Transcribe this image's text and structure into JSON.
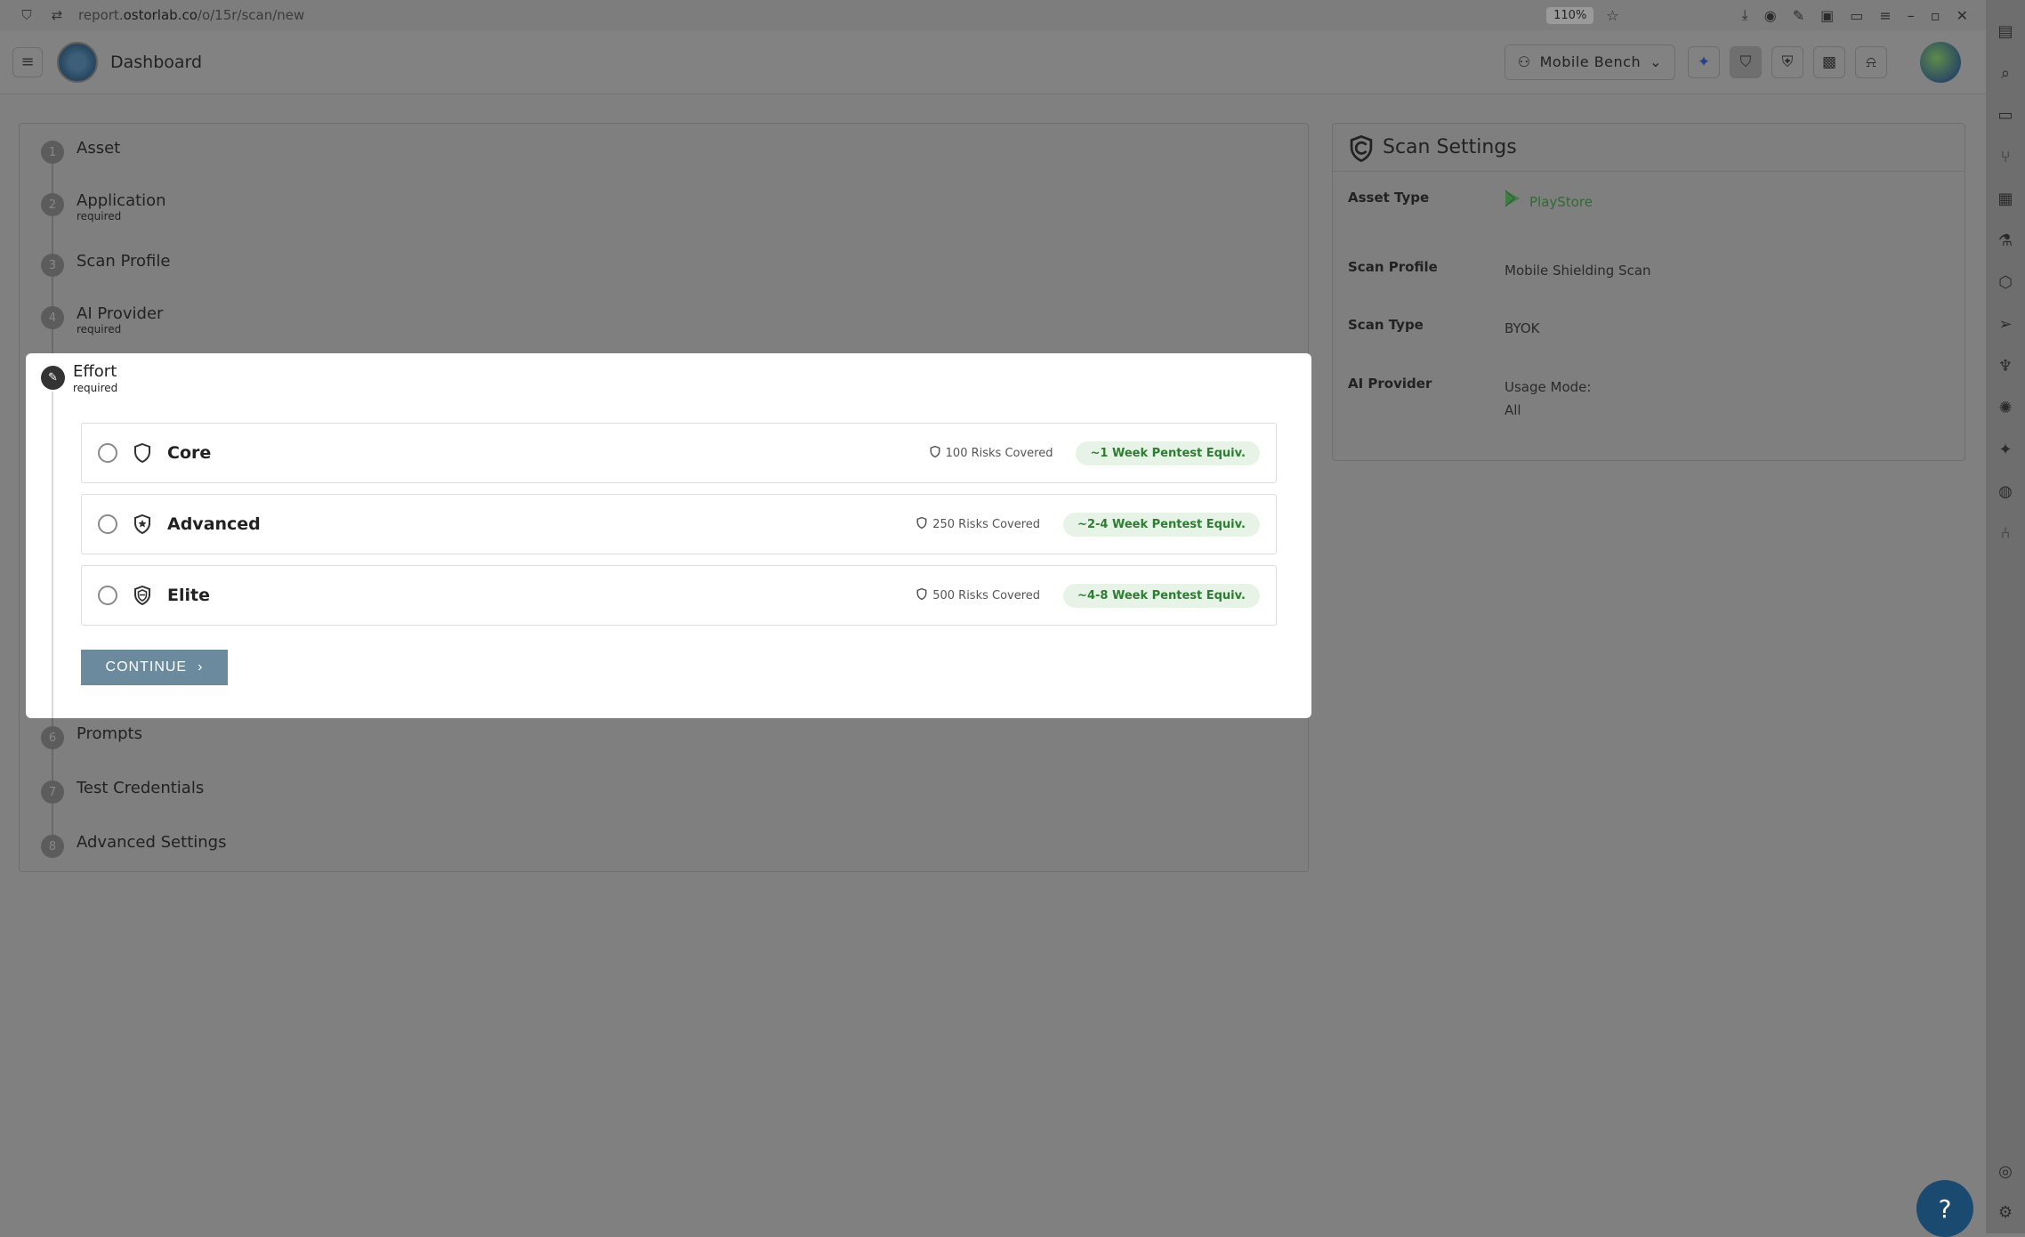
{
  "browser": {
    "url_prefix": "report.",
    "url_domain": "ostorlab.co",
    "url_path": "/o/15r/scan/new",
    "zoom": "110%"
  },
  "header": {
    "title": "Dashboard",
    "org": "Mobile Bench"
  },
  "steps": [
    {
      "num": "1",
      "label": "Asset",
      "required": ""
    },
    {
      "num": "2",
      "label": "Application",
      "required": "required"
    },
    {
      "num": "3",
      "label": "Scan Profile",
      "required": ""
    },
    {
      "num": "4",
      "label": "AI Provider",
      "required": "required"
    },
    {
      "num": "6",
      "label": "Prompts",
      "required": ""
    },
    {
      "num": "7",
      "label": "Test Credentials",
      "required": ""
    },
    {
      "num": "8",
      "label": "Advanced Settings",
      "required": ""
    }
  ],
  "effort": {
    "title": "Effort",
    "required": "required",
    "options": [
      {
        "name": "Core",
        "risks": "100 Risks Covered",
        "badge": "~1 Week Pentest Equiv."
      },
      {
        "name": "Advanced",
        "risks": "250 Risks Covered",
        "badge": "~2-4 Week Pentest Equiv."
      },
      {
        "name": "Elite",
        "risks": "500 Risks Covered",
        "badge": "~4-8 Week Pentest Equiv."
      }
    ],
    "continue": "CONTINUE"
  },
  "settings": {
    "title": "Scan Settings",
    "asset_type_label": "Asset Type",
    "asset_type_value": "PlayStore",
    "scan_profile_label": "Scan Profile",
    "scan_profile_value": "Mobile Shielding Scan",
    "scan_type_label": "Scan Type",
    "scan_type_value": "BYOK",
    "ai_provider_label": "AI Provider",
    "ai_provider_value_1": "Usage Mode:",
    "ai_provider_value_2": "All"
  },
  "help_label": "?"
}
